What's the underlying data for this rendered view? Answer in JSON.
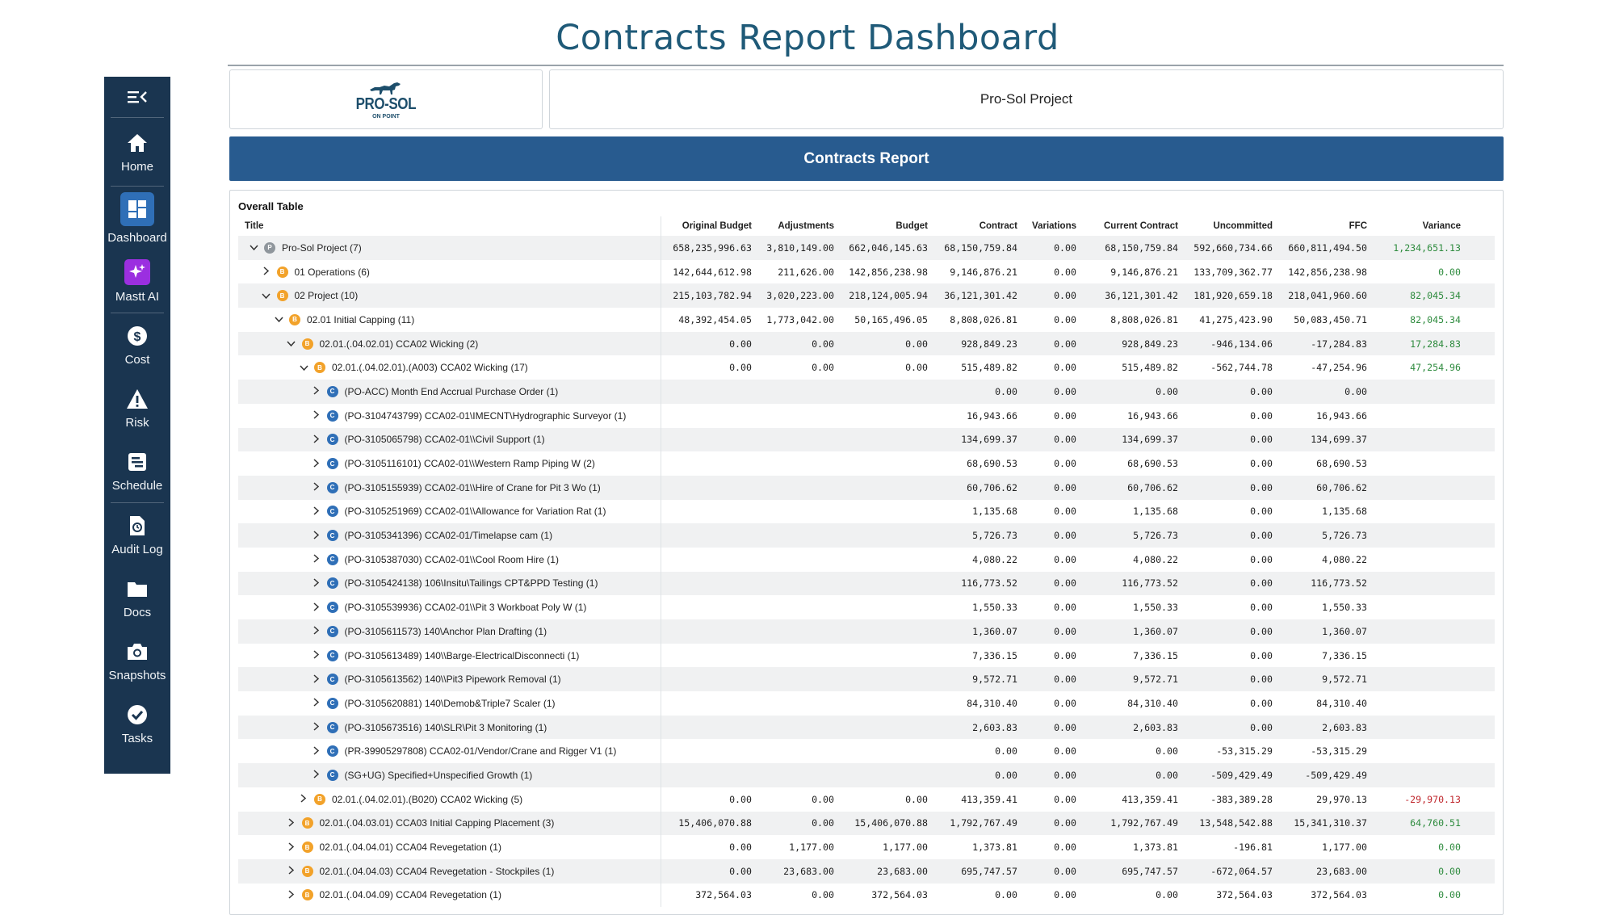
{
  "page_title": "Contracts Report Dashboard",
  "sidebar": {
    "items": [
      {
        "label": "Home",
        "icon": "home-icon"
      },
      {
        "label": "Dashboard",
        "icon": "dashboard-icon"
      },
      {
        "label": "Mastt AI",
        "icon": "sparkle-icon"
      },
      {
        "label": "Cost",
        "icon": "dollar-icon"
      },
      {
        "label": "Risk",
        "icon": "warning-icon"
      },
      {
        "label": "Schedule",
        "icon": "schedule-icon"
      },
      {
        "label": "Audit Log",
        "icon": "audit-icon"
      },
      {
        "label": "Docs",
        "icon": "folder-icon"
      },
      {
        "label": "Snapshots",
        "icon": "camera-icon"
      },
      {
        "label": "Tasks",
        "icon": "check-icon"
      }
    ]
  },
  "logo": {
    "word": "PRO-SOL",
    "sub": "ON POINT"
  },
  "project_name": "Pro-Sol Project",
  "report_title": "Contracts Report",
  "table": {
    "caption": "Overall Table",
    "columns": [
      "Title",
      "Original Budget",
      "Adjustments",
      "Budget",
      "Contract",
      "Variations",
      "Current Contract",
      "Uncommitted",
      "FFC",
      "Variance"
    ],
    "rows": [
      {
        "level": 0,
        "chev": "v",
        "badge": "P",
        "title": "Pro-Sol Project  (7)",
        "vals": [
          "658,235,996.63",
          "3,810,149.00",
          "662,046,145.63",
          "68,150,759.84",
          "0.00",
          "68,150,759.84",
          "592,660,734.66",
          "660,811,494.50",
          "1,234,651.13"
        ],
        "var": "pos"
      },
      {
        "level": 1,
        "chev": ">",
        "badge": "B",
        "title": "01 Operations  (6)",
        "vals": [
          "142,644,612.98",
          "211,626.00",
          "142,856,238.98",
          "9,146,876.21",
          "0.00",
          "9,146,876.21",
          "133,709,362.77",
          "142,856,238.98",
          "0.00"
        ],
        "var": "pos"
      },
      {
        "level": 1,
        "chev": "v",
        "badge": "B",
        "title": "02 Project  (10)",
        "vals": [
          "215,103,782.94",
          "3,020,223.00",
          "218,124,005.94",
          "36,121,301.42",
          "0.00",
          "36,121,301.42",
          "181,920,659.18",
          "218,041,960.60",
          "82,045.34"
        ],
        "var": "pos"
      },
      {
        "level": 2,
        "chev": "v",
        "badge": "B",
        "title": "02.01 Initial Capping  (11)",
        "vals": [
          "48,392,454.05",
          "1,773,042.00",
          "50,165,496.05",
          "8,808,026.81",
          "0.00",
          "8,808,026.81",
          "41,275,423.90",
          "50,083,450.71",
          "82,045.34"
        ],
        "var": "pos"
      },
      {
        "level": 3,
        "chev": "v",
        "badge": "B",
        "title": "02.01.(.04.02.01) CCA02 Wicking  (2)",
        "vals": [
          "0.00",
          "0.00",
          "0.00",
          "928,849.23",
          "0.00",
          "928,849.23",
          "-946,134.06",
          "-17,284.83",
          "17,284.83"
        ],
        "var": "pos"
      },
      {
        "level": 4,
        "chev": "v",
        "badge": "B",
        "title": "02.01.(.04.02.01).(A003) CCA02 Wicking  (17)",
        "vals": [
          "0.00",
          "0.00",
          "0.00",
          "515,489.82",
          "0.00",
          "515,489.82",
          "-562,744.78",
          "-47,254.96",
          "47,254.96"
        ],
        "var": "pos"
      },
      {
        "level": 5,
        "chev": ">",
        "badge": "C",
        "title": "(PO-ACC) Month End Accrual Purchase Order  (1)",
        "vals": [
          "",
          "",
          "",
          "0.00",
          "0.00",
          "0.00",
          "0.00",
          "0.00",
          ""
        ],
        "var": ""
      },
      {
        "level": 5,
        "chev": ">",
        "badge": "C",
        "title": "(PO-3104743799) CCA02-01\\IMECNT\\Hydrographic Surveyor  (1)",
        "vals": [
          "",
          "",
          "",
          "16,943.66",
          "0.00",
          "16,943.66",
          "0.00",
          "16,943.66",
          ""
        ],
        "var": ""
      },
      {
        "level": 5,
        "chev": ">",
        "badge": "C",
        "title": "(PO-3105065798) CCA02-01\\\\Civil Support  (1)",
        "vals": [
          "",
          "",
          "",
          "134,699.37",
          "0.00",
          "134,699.37",
          "0.00",
          "134,699.37",
          ""
        ],
        "var": ""
      },
      {
        "level": 5,
        "chev": ">",
        "badge": "C",
        "title": "(PO-3105116101) CCA02-01\\\\Western Ramp Piping W  (2)",
        "vals": [
          "",
          "",
          "",
          "68,690.53",
          "0.00",
          "68,690.53",
          "0.00",
          "68,690.53",
          ""
        ],
        "var": ""
      },
      {
        "level": 5,
        "chev": ">",
        "badge": "C",
        "title": "(PO-3105155939) CCA02-01\\\\Hire of Crane for Pit 3 Wo  (1)",
        "vals": [
          "",
          "",
          "",
          "60,706.62",
          "0.00",
          "60,706.62",
          "0.00",
          "60,706.62",
          ""
        ],
        "var": ""
      },
      {
        "level": 5,
        "chev": ">",
        "badge": "C",
        "title": "(PO-3105251969) CCA02-01\\\\Allowance for Variation Rat  (1)",
        "vals": [
          "",
          "",
          "",
          "1,135.68",
          "0.00",
          "1,135.68",
          "0.00",
          "1,135.68",
          ""
        ],
        "var": ""
      },
      {
        "level": 5,
        "chev": ">",
        "badge": "C",
        "title": "(PO-3105341396) CCA02-01/Timelapse cam  (1)",
        "vals": [
          "",
          "",
          "",
          "5,726.73",
          "0.00",
          "5,726.73",
          "0.00",
          "5,726.73",
          ""
        ],
        "var": ""
      },
      {
        "level": 5,
        "chev": ">",
        "badge": "C",
        "title": "(PO-3105387030) CCA02-01\\\\Cool Room Hire  (1)",
        "vals": [
          "",
          "",
          "",
          "4,080.22",
          "0.00",
          "4,080.22",
          "0.00",
          "4,080.22",
          ""
        ],
        "var": ""
      },
      {
        "level": 5,
        "chev": ">",
        "badge": "C",
        "title": "(PO-3105424138) 106\\Insitu\\Tailings CPT&PPD Testing  (1)",
        "vals": [
          "",
          "",
          "",
          "116,773.52",
          "0.00",
          "116,773.52",
          "0.00",
          "116,773.52",
          ""
        ],
        "var": ""
      },
      {
        "level": 5,
        "chev": ">",
        "badge": "C",
        "title": "(PO-3105539936) CCA02-01\\\\Pit 3 Workboat Poly W  (1)",
        "vals": [
          "",
          "",
          "",
          "1,550.33",
          "0.00",
          "1,550.33",
          "0.00",
          "1,550.33",
          ""
        ],
        "var": ""
      },
      {
        "level": 5,
        "chev": ">",
        "badge": "C",
        "title": "(PO-3105611573) 140\\Anchor Plan Drafting  (1)",
        "vals": [
          "",
          "",
          "",
          "1,360.07",
          "0.00",
          "1,360.07",
          "0.00",
          "1,360.07",
          ""
        ],
        "var": ""
      },
      {
        "level": 5,
        "chev": ">",
        "badge": "C",
        "title": "(PO-3105613489) 140\\\\Barge-ElectricalDisconnecti  (1)",
        "vals": [
          "",
          "",
          "",
          "7,336.15",
          "0.00",
          "7,336.15",
          "0.00",
          "7,336.15",
          ""
        ],
        "var": ""
      },
      {
        "level": 5,
        "chev": ">",
        "badge": "C",
        "title": "(PO-3105613562) 140\\\\Pit3 Pipework Removal  (1)",
        "vals": [
          "",
          "",
          "",
          "9,572.71",
          "0.00",
          "9,572.71",
          "0.00",
          "9,572.71",
          ""
        ],
        "var": ""
      },
      {
        "level": 5,
        "chev": ">",
        "badge": "C",
        "title": "(PO-3105620881) 140\\Demob&Triple7 Scaler  (1)",
        "vals": [
          "",
          "",
          "",
          "84,310.40",
          "0.00",
          "84,310.40",
          "0.00",
          "84,310.40",
          ""
        ],
        "var": ""
      },
      {
        "level": 5,
        "chev": ">",
        "badge": "C",
        "title": "(PO-3105673516) 140\\SLR\\Pit 3 Monitoring  (1)",
        "vals": [
          "",
          "",
          "",
          "2,603.83",
          "0.00",
          "2,603.83",
          "0.00",
          "2,603.83",
          ""
        ],
        "var": ""
      },
      {
        "level": 5,
        "chev": ">",
        "badge": "C",
        "title": "(PR-39905297808) CCA02-01/Vendor/Crane and Rigger V1  (1)",
        "vals": [
          "",
          "",
          "",
          "0.00",
          "0.00",
          "0.00",
          "-53,315.29",
          "-53,315.29",
          ""
        ],
        "var": ""
      },
      {
        "level": 5,
        "chev": ">",
        "badge": "C",
        "title": "(SG+UG) Specified+Unspecified Growth  (1)",
        "vals": [
          "",
          "",
          "",
          "0.00",
          "0.00",
          "0.00",
          "-509,429.49",
          "-509,429.49",
          ""
        ],
        "var": ""
      },
      {
        "level": 4,
        "chev": ">",
        "badge": "B",
        "title": "02.01.(.04.02.01).(B020) CCA02 Wicking  (5)",
        "vals": [
          "0.00",
          "0.00",
          "0.00",
          "413,359.41",
          "0.00",
          "413,359.41",
          "-383,389.28",
          "29,970.13",
          "-29,970.13"
        ],
        "var": "neg"
      },
      {
        "level": 3,
        "chev": ">",
        "badge": "B",
        "title": "02.01.(.04.03.01) CCA03 Initial Capping Placement  (3)",
        "vals": [
          "15,406,070.88",
          "0.00",
          "15,406,070.88",
          "1,792,767.49",
          "0.00",
          "1,792,767.49",
          "13,548,542.88",
          "15,341,310.37",
          "64,760.51"
        ],
        "var": "pos"
      },
      {
        "level": 3,
        "chev": ">",
        "badge": "B",
        "title": "02.01.(.04.04.01) CCA04 Revegetation  (1)",
        "vals": [
          "0.00",
          "1,177.00",
          "1,177.00",
          "1,373.81",
          "0.00",
          "1,373.81",
          "-196.81",
          "1,177.00",
          "0.00"
        ],
        "var": "pos"
      },
      {
        "level": 3,
        "chev": ">",
        "badge": "B",
        "title": "02.01.(.04.04.03) CCA04 Revegetation - Stockpiles  (1)",
        "vals": [
          "0.00",
          "23,683.00",
          "23,683.00",
          "695,747.57",
          "0.00",
          "695,747.57",
          "-672,064.57",
          "23,683.00",
          "0.00"
        ],
        "var": "pos"
      },
      {
        "level": 3,
        "chev": ">",
        "badge": "B",
        "title": "02.01.(.04.04.09) CCA04 Revegetation  (1)",
        "vals": [
          "372,564.03",
          "0.00",
          "372,564.03",
          "0.00",
          "0.00",
          "0.00",
          "372,564.03",
          "372,564.03",
          "0.00"
        ],
        "var": "pos"
      }
    ]
  }
}
